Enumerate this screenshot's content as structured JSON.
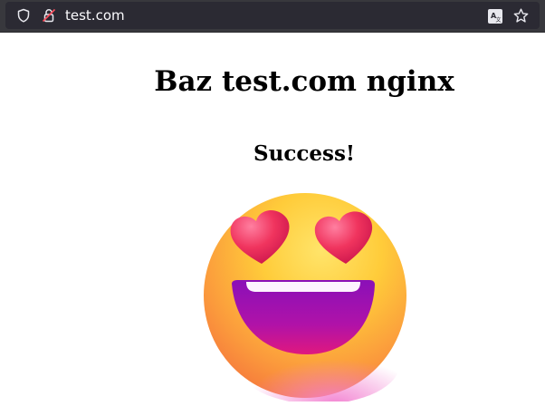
{
  "browser": {
    "url": "test.com",
    "icons": [
      "shield-icon",
      "lock-icon",
      "translate-icon",
      "bookmark-star-icon"
    ]
  },
  "page": {
    "title": "Baz test.com nginx",
    "subtitle": "Success!",
    "image": "smiling-face-with-heart-eyes-emoji"
  }
}
